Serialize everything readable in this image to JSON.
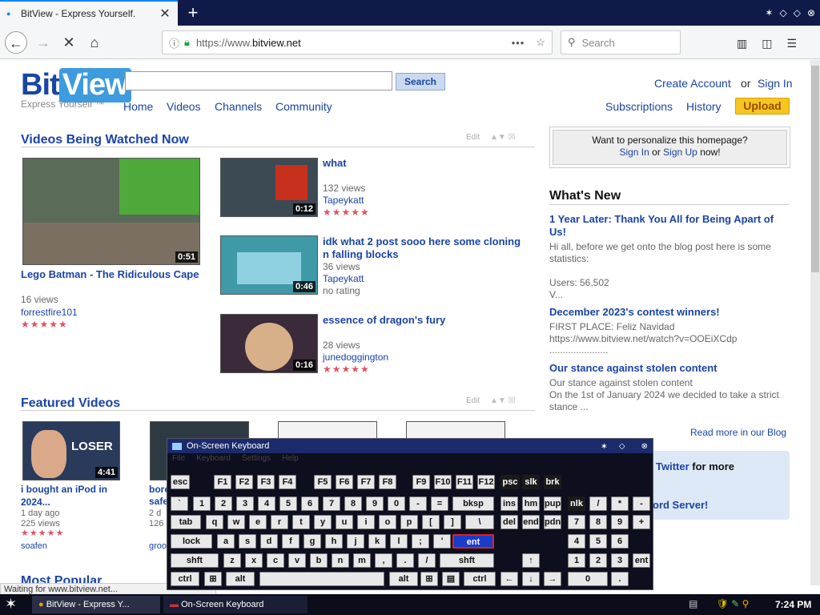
{
  "browser": {
    "tab_title": "BitView - Express Yourself.",
    "url_prefix": "https://www.",
    "url_domain": "bitview.net",
    "search_placeholder": "Search"
  },
  "site": {
    "logo_bit": "Bit",
    "logo_view": "View",
    "tagline": "Express Yourself ™",
    "search_button": "Search",
    "nav": [
      "Home",
      "Videos",
      "Channels",
      "Community"
    ],
    "create_account": "Create Account",
    "or": "or",
    "sign_in": "Sign In",
    "subscriptions": "Subscriptions",
    "history": "History",
    "upload": "Upload"
  },
  "watched": {
    "title": "Videos Being Watched Now",
    "edit": "Edit",
    "main": {
      "duration": "0:51",
      "title": "Lego Batman - The Ridiculous Cape",
      "views": "16 views",
      "user": "forrestfire101",
      "stars": "★★★★★"
    },
    "items": [
      {
        "duration": "0:12",
        "title": "what",
        "views": "132 views",
        "user": "Tapeykatt",
        "rating": "★★★★★"
      },
      {
        "duration": "0:46",
        "title": "idk what 2 post sooo here some cloning n falling blocks",
        "views": "36 views",
        "user": "Tapeykatt",
        "rating": "no rating"
      },
      {
        "duration": "0:16",
        "title": "essence of dragon's fury",
        "views": "28 views",
        "user": "junedoggington",
        "rating": "★★★★★"
      }
    ]
  },
  "personalize": {
    "text": "Want to personalize this homepage?",
    "sign_in": "Sign In",
    "or": "or",
    "sign_up": "Sign Up",
    "now": "now!"
  },
  "whats_new": {
    "title": "What's New",
    "posts": [
      {
        "title": "1 Year Later: Thank You All for Being Apart of Us!",
        "body": "Hi all, before we get onto the blog post here is some statistics:",
        "extra1": "Users: 56,502",
        "extra2": "V..."
      },
      {
        "title": "December 2023's contest winners!",
        "body": "FIRST PLACE: Feliz Navidad",
        "extra1": "https://www.bitview.net/watch?v=OOEiXCdp",
        "extra2": "......................"
      },
      {
        "title": "Our stance against stolen content",
        "body": "Our stance against stolen content",
        "extra1": "On the 1st of January 2024 we decided to take a strict stance ..."
      }
    ],
    "read_more": "Read more in our Blog",
    "twitter": "Twitter",
    "for_more": "for more",
    "discord": "ord Server!"
  },
  "featured": {
    "title": "Featured Videos",
    "edit": "Edit",
    "items": [
      {
        "duration": "4:41",
        "title": "i bought an iPod in 2024...",
        "age": "1 day ago",
        "views": "225 views",
        "user": "soafen",
        "thumb_text": "LOSER"
      },
      {
        "title": "bore",
        "title2": "safe",
        "age": "2 d",
        "views": "126",
        "user": "groo"
      }
    ]
  },
  "most_popular": "Most Popular",
  "status_text": "Waiting for www.bitview.net...",
  "osk": {
    "title": "On-Screen Keyboard",
    "menu": [
      "File",
      "Keyboard",
      "Settings",
      "Help"
    ]
  },
  "taskbar": {
    "item1": "BitView - Express Y...",
    "item2": "On-Screen Keyboard",
    "clock": "7:24 PM"
  }
}
